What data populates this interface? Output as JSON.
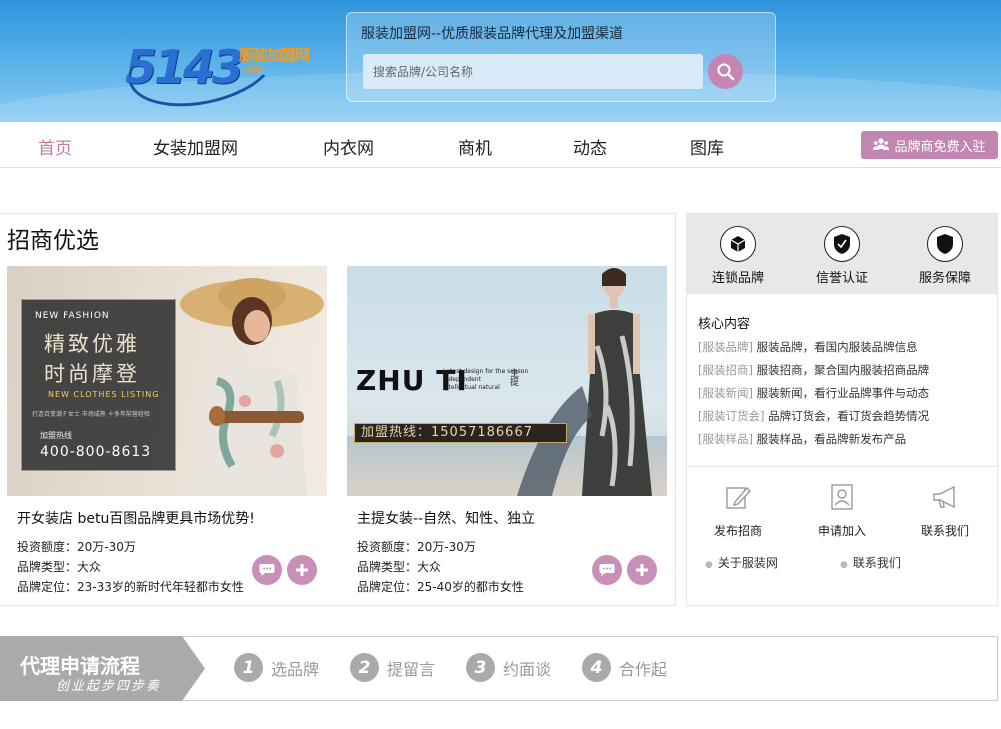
{
  "header": {
    "logo": {
      "number": "5143",
      "name": "服装加盟网",
      "domain": ".CN"
    },
    "tagline": "服装加盟网--优质服装品牌代理及加盟渠道",
    "search": {
      "placeholder": "搜索品牌/公司名称",
      "value": ""
    },
    "search_icon": "magnifier-icon"
  },
  "nav": {
    "items": [
      "首页",
      "女装加盟网",
      "内衣网",
      "商机",
      "动态",
      "图库"
    ],
    "active": "首页",
    "join_label": "品牌商免费入驻",
    "join_icon": "people-group-icon"
  },
  "featured": {
    "title": "招商优选",
    "cards": [
      {
        "title": "开女装店 betu百图品牌更具市场优势!",
        "invest": "投资额度：20万-30万",
        "type": "品牌类型：大众",
        "position": "品牌定位：23-33岁的新时代年轻都市女性",
        "image": {
          "tag": "NEW FASHION",
          "line1": "精致优雅",
          "line2": "时尚摩登",
          "listing": "NEW CLOTHES LISTING",
          "small": "打造百变潮Ｆ女士  市场成熟  十多年前营经验",
          "hotline_label": "加盟热线",
          "hotline": "400-800-8613"
        },
        "buttons": [
          "chat-icon",
          "plus-icon"
        ]
      },
      {
        "title": "主提女装--自然、知性、独立",
        "invest": "投资额度：20万-30万",
        "type": "品牌类型：大众",
        "position": "品牌定位：25-40岁的都市女性",
        "image": {
          "brand": "ZHU TI",
          "sub1": "Latest design for the season",
          "sub2": "independent",
          "sub3": "Intellectual natural",
          "brand_cn": "主提",
          "hotline": "加盟热线：15057186667"
        },
        "buttons": [
          "chat-icon",
          "plus-icon"
        ]
      }
    ]
  },
  "sidebar": {
    "features": [
      {
        "label": "连锁品牌",
        "icon": "cube-icon"
      },
      {
        "label": "信誉认证",
        "icon": "shield-check-icon"
      },
      {
        "label": "服务保障",
        "icon": "shield-icon"
      }
    ],
    "core_title": "核心内容",
    "core_items": [
      {
        "tag": "[服装品牌]",
        "text": "服装品牌，看国内服装品牌信息"
      },
      {
        "tag": "[服装招商]",
        "text": "服装招商，聚合国内服装招商品牌"
      },
      {
        "tag": "[服装新闻]",
        "text": "服装新闻，看行业品牌事件与动态"
      },
      {
        "tag": "[服装订货会]",
        "text": "品牌订货会，看订货会趋势情况"
      },
      {
        "tag": "[服装样品]",
        "text": "服装样品，看品牌新发布产品"
      }
    ],
    "actions": [
      {
        "label": "发布招商",
        "icon": "edit-icon"
      },
      {
        "label": "申请加入",
        "icon": "profile-card-icon"
      },
      {
        "label": "联系我们",
        "icon": "megaphone-icon"
      }
    ],
    "links": [
      "关于服装网",
      "联系我们"
    ]
  },
  "process": {
    "title": "代理申请流程",
    "subtitle": "创业起步四步奏",
    "steps": [
      {
        "num": "1",
        "label": "选品牌"
      },
      {
        "num": "2",
        "label": "提留言"
      },
      {
        "num": "3",
        "label": "约面谈"
      },
      {
        "num": "4",
        "label": "合作起"
      }
    ]
  },
  "colors": {
    "accent": "#c586b4",
    "header_blue": "#2f94dc",
    "logo_orange": "#f39c1f"
  }
}
